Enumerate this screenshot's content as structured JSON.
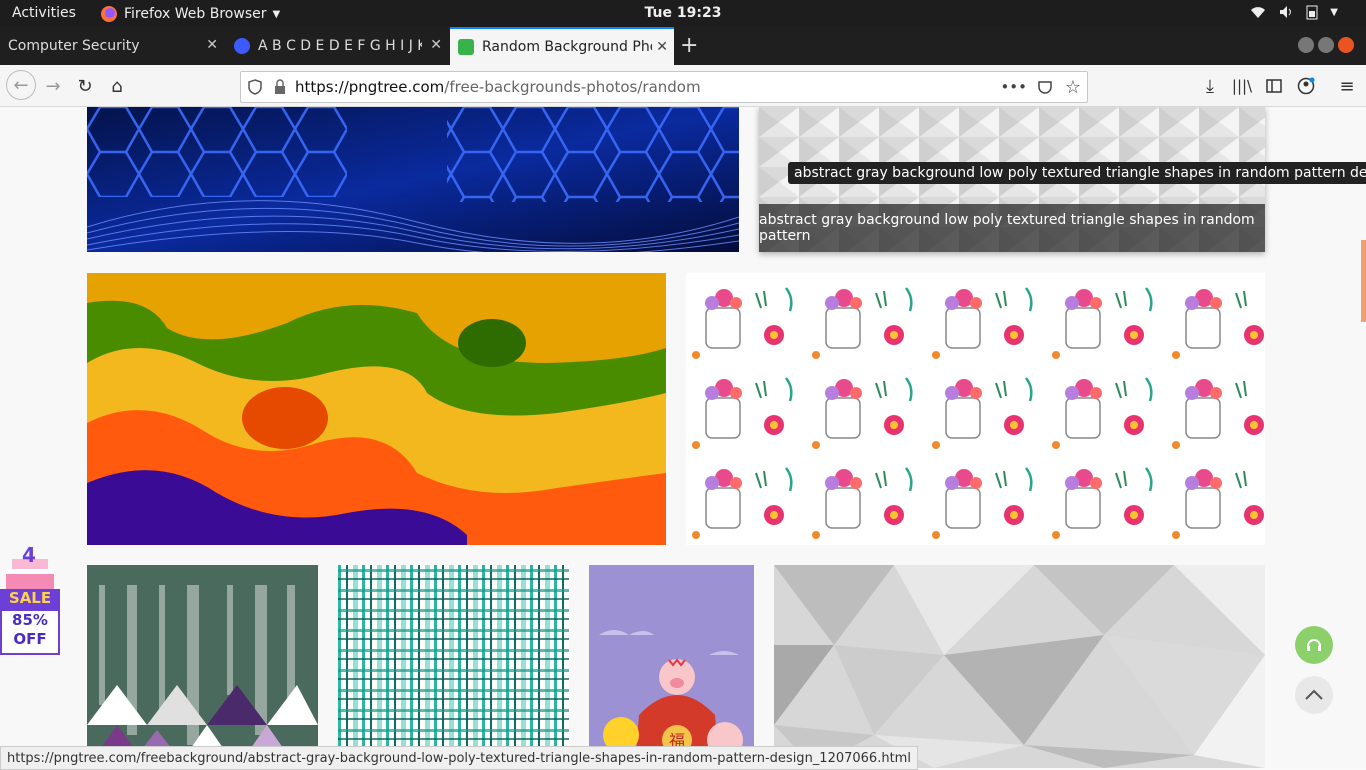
{
  "topbar": {
    "activities": "Activities",
    "app_name": "Firefox Web Browser",
    "clock": "Tue 19:23"
  },
  "tabs": [
    {
      "label": "Computer Security",
      "active": false
    },
    {
      "label": "A B C D E D E F G H I J K L",
      "active": false
    },
    {
      "label": "Random Background Pho",
      "active": true
    }
  ],
  "navbar": {
    "url_host": "https://pngtree.com",
    "url_path": "/free-backgrounds-photos/random",
    "url_more": "•••"
  },
  "page": {
    "tooltip": "abstract gray background low poly textured triangle shapes in random pattern design",
    "gray_caption": "abstract gray background low poly textured triangle shapes in random pattern",
    "sale": {
      "top": "4",
      "label": "SALE",
      "pct": "85%",
      "off": "OFF"
    }
  },
  "status_url": "https://pngtree.com/freebackground/abstract-gray-background-low-poly-textured-triangle-shapes-in-random-pattern-design_1207066.html",
  "colors": {
    "accent": "#0a84ff",
    "sale_purple": "#6c3fd6",
    "support_green": "#8bd06a"
  }
}
